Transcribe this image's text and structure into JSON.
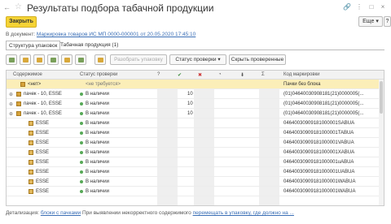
{
  "window": {
    "title": "Результаты подбора табачной продукции",
    "nav_back": "←",
    "nav_forward": "→",
    "star": "☆",
    "link_icon": "🔗",
    "menu_icon": "⋮",
    "maximize_icon": "□",
    "close_icon": "×"
  },
  "toolbar": {
    "close_label": "Закрыть",
    "more_label": "Еще ▾",
    "help_label": "?"
  },
  "document": {
    "prefix": "В документ:",
    "link": "Маркировка товаров ИС МП 0000-000001 от 20.05.2020 17:45:10"
  },
  "tabs": [
    {
      "label": "Структура упаковок",
      "active": true
    },
    {
      "label": "Табачная продукция (1)",
      "active": false
    }
  ],
  "actions": {
    "unpack": "Разобрать упаковку",
    "check_status": "Статус проверки ▾",
    "hide_checked": "Скрыть проверенные"
  },
  "columns": {
    "content": "Содержимое",
    "check_status": "Статус проверки",
    "q": "?",
    "ok": "✔",
    "err": "✖",
    "pie": "◔",
    "down": "⬇",
    "sum": "Σ",
    "code": "Код маркировки"
  },
  "rows": [
    {
      "content": "<нет>",
      "status": "<не требуется>",
      "ok": "",
      "sum": "",
      "code": "Пачки без блока",
      "selected": true,
      "kind": "none"
    },
    {
      "content": "пачек - 10, ESSE",
      "status": "В наличии",
      "ok": "10",
      "sum": "",
      "code": "(01)04640030908181(21)0000005(...",
      "kind": "block"
    },
    {
      "content": "пачек - 10, ESSE",
      "status": "В наличии",
      "ok": "10",
      "sum": "",
      "code": "(01)04640030908181(21)0000005(...",
      "kind": "block"
    },
    {
      "content": "пачек - 10, ESSE",
      "status": "В наличии",
      "ok": "10",
      "sum": "",
      "code": "(01)04640030908181(21)0000005(...",
      "kind": "block"
    },
    {
      "content": "ESSE",
      "status": "В наличии",
      "ok": "",
      "sum": "",
      "code": "04640030909181000001SABUA",
      "kind": "pack"
    },
    {
      "content": "ESSE",
      "status": "В наличии",
      "ok": "",
      "sum": "",
      "code": "04640030909181000001TABUA",
      "kind": "pack"
    },
    {
      "content": "ESSE",
      "status": "В наличии",
      "ok": "",
      "sum": "",
      "code": "04640030909181000001VABUA",
      "kind": "pack"
    },
    {
      "content": "ESSE",
      "status": "В наличии",
      "ok": "",
      "sum": "",
      "code": "04640030909181000001XABUA",
      "kind": "pack"
    },
    {
      "content": "ESSE",
      "status": "В наличии",
      "ok": "",
      "sum": "",
      "code": "04640030909181000001uABUA",
      "kind": "pack"
    },
    {
      "content": "ESSE",
      "status": "В наличии",
      "ok": "",
      "sum": "",
      "code": "04640030909181000001UABUA",
      "kind": "pack"
    },
    {
      "content": "ESSE",
      "status": "В наличии",
      "ok": "",
      "sum": "",
      "code": "04640030909181000001WABUA",
      "kind": "pack"
    },
    {
      "content": "ESSE",
      "status": "В наличии",
      "ok": "",
      "sum": "",
      "code": "04640030909181000001WABUA",
      "kind": "pack"
    }
  ],
  "footer": {
    "prefix": "Детализация:",
    "link1": "блоки с пачками",
    "middle": "При выявлении некорректного содержимого",
    "link2": "перемещать в упаковку, где должно на ..."
  }
}
